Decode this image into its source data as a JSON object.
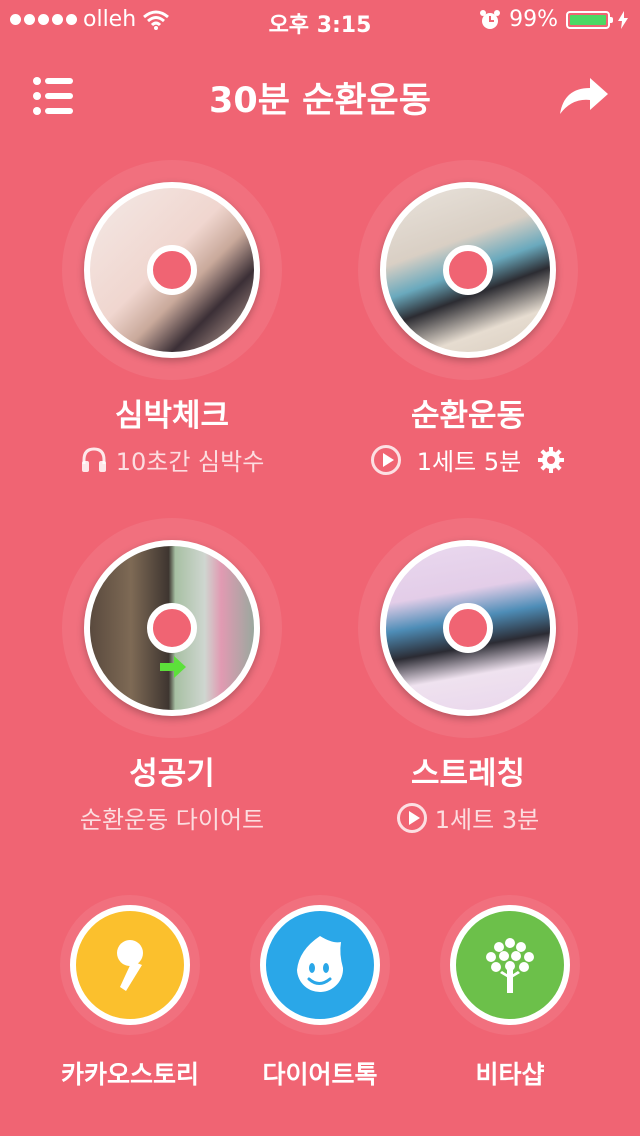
{
  "status": {
    "carrier": "olleh",
    "time": "오후 3:15",
    "battery": "99%",
    "battery_level": 0.99
  },
  "header": {
    "title": "30분 순환운동"
  },
  "cards": [
    {
      "title": "심박체크",
      "subtitle": "10초간 심박수"
    },
    {
      "title": "순환운동",
      "subtitle": "1세트 5분"
    },
    {
      "title": "성공기",
      "subtitle": "순환운동 다이어트"
    },
    {
      "title": "스트레칭",
      "subtitle": "1세트 3분"
    }
  ],
  "apps": [
    {
      "label": "카카오스토리",
      "color": "#fbc02d"
    },
    {
      "label": "다이어트톡",
      "color": "#2aa7e8"
    },
    {
      "label": "비타샵",
      "color": "#6cc04a"
    }
  ],
  "colors": {
    "background": "#f06473"
  }
}
